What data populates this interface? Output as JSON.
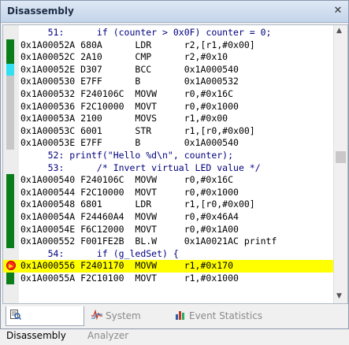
{
  "window": {
    "title": "Disassembly",
    "close_glyph": "✕"
  },
  "lines": [
    {
      "kind": "src",
      "mark": "none",
      "text": "     51:      if (counter > 0x0F) counter = 0;"
    },
    {
      "kind": "asm",
      "mark": "green",
      "text": "0x1A00052A 680A      LDR      r2,[r1,#0x00]"
    },
    {
      "kind": "asm",
      "mark": "green",
      "text": "0x1A00052C 2A10      CMP      r2,#0x10"
    },
    {
      "kind": "asm",
      "mark": "cyan",
      "text": "0x1A00052E D307      BCC      0x1A000540"
    },
    {
      "kind": "asm",
      "mark": "gray",
      "text": "0x1A000530 E7FF      B        0x1A000532"
    },
    {
      "kind": "asm",
      "mark": "gray",
      "text": "0x1A000532 F240106C  MOVW     r0,#0x16C"
    },
    {
      "kind": "asm",
      "mark": "gray",
      "text": "0x1A000536 F2C10000  MOVT     r0,#0x1000"
    },
    {
      "kind": "asm",
      "mark": "gray",
      "text": "0x1A00053A 2100      MOVS     r1,#0x00"
    },
    {
      "kind": "asm",
      "mark": "gray",
      "text": "0x1A00053C 6001      STR      r1,[r0,#0x00]"
    },
    {
      "kind": "asm",
      "mark": "gray",
      "text": "0x1A00053E E7FF      B        0x1A000540"
    },
    {
      "kind": "src",
      "mark": "none",
      "text": "     52: printf(\"Hello %d\\n\", counter);"
    },
    {
      "kind": "src",
      "mark": "none",
      "text": "     53:      /* Invert virtual LED value */"
    },
    {
      "kind": "asm",
      "mark": "green",
      "text": "0x1A000540 F240106C  MOVW     r0,#0x16C"
    },
    {
      "kind": "asm",
      "mark": "green",
      "text": "0x1A000544 F2C10000  MOVT     r0,#0x1000"
    },
    {
      "kind": "asm",
      "mark": "green",
      "text": "0x1A000548 6801      LDR      r1,[r0,#0x00]"
    },
    {
      "kind": "asm",
      "mark": "green",
      "text": "0x1A00054A F24460A4  MOVW     r0,#0x46A4"
    },
    {
      "kind": "asm",
      "mark": "green",
      "text": "0x1A00054E F6C12000  MOVT     r0,#0x1A00"
    },
    {
      "kind": "asm",
      "mark": "green",
      "text": "0x1A000552 F001FE2B  BL.W     0x1A0021AC printf"
    },
    {
      "kind": "src",
      "mark": "none",
      "text": "     54:      if (g_ledSet) {"
    },
    {
      "kind": "asm",
      "mark": "current",
      "text": "0x1A000556 F2401170  MOVW     r1,#0x170"
    },
    {
      "kind": "asm",
      "mark": "green",
      "text": "0x1A00055A F2C10100  MOVT     r1,#0x1000"
    }
  ],
  "scroll": {
    "up_glyph": "▲",
    "down_glyph": "▼"
  },
  "tabs": [
    {
      "label": "Disassembly",
      "icon": "disassembly-icon",
      "active": true
    },
    {
      "label": "System Analyzer",
      "icon": "system-analyzer-icon",
      "active": false
    },
    {
      "label": "Event Statistics",
      "icon": "event-statistics-icon",
      "active": false
    }
  ],
  "colors": {
    "current_line": "#ffff00",
    "executed": "#0b7d1a",
    "branch": "#33e0f2",
    "not_executed": "#c8c8c8"
  }
}
